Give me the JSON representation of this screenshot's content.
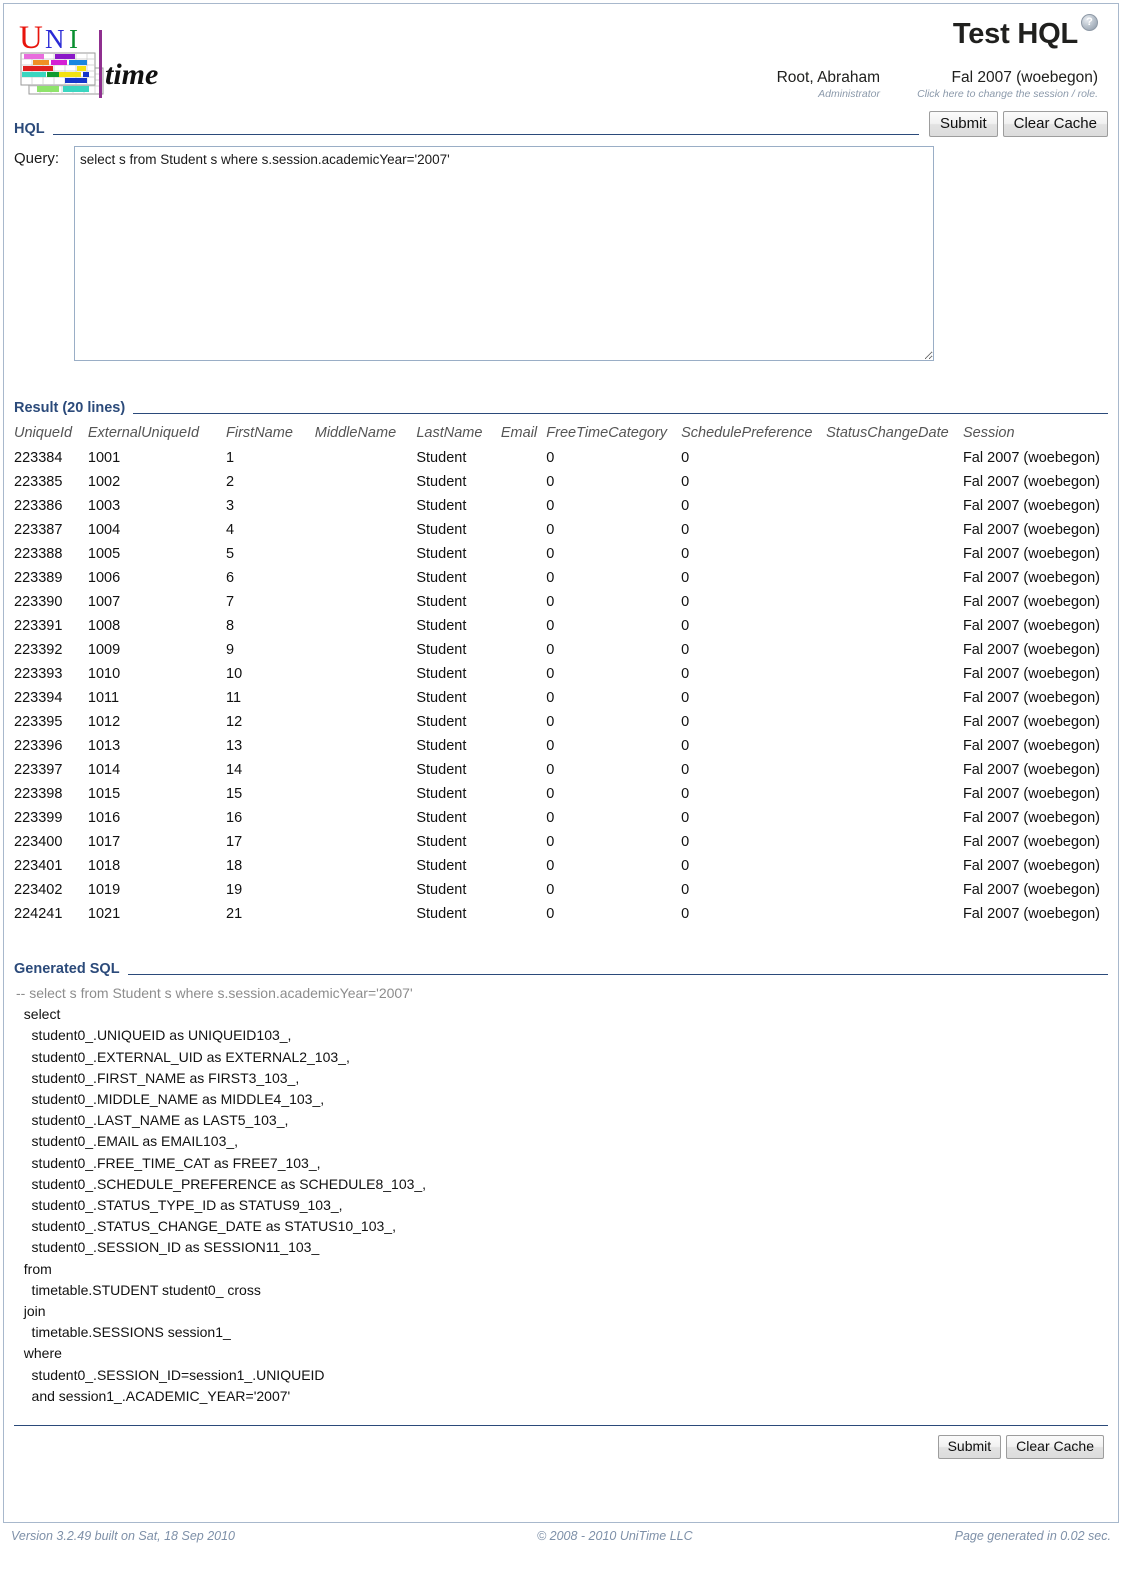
{
  "header": {
    "app_title": "Test HQL",
    "help_badge": "?",
    "logo_alt": "UniTime",
    "logo_text_uni": "UNI",
    "logo_text_time": "time",
    "user_name": "Root, Abraham",
    "user_role": "Administrator",
    "session_name": "Fal 2007 (woebegon)",
    "session_hint": "Click here to change the session / role."
  },
  "hql_section": {
    "title": "HQL",
    "submit_label": "Submit",
    "clear_cache_label": "Clear Cache",
    "query_label": "Query:",
    "query_value": "select s from Student s where s.session.academicYear='2007'",
    "query_placeholder": ""
  },
  "result_section": {
    "title": "Result (20 lines)",
    "columns": [
      "UniqueId",
      "ExternalUniqueId",
      "FirstName",
      "MiddleName",
      "LastName",
      "Email",
      "FreeTimeCategory",
      "SchedulePreference",
      "StatusChangeDate",
      "Session"
    ],
    "rows": [
      [
        "223384",
        "1001",
        "1",
        "",
        "Student",
        "",
        "0",
        "0",
        "",
        "Fal 2007 (woebegon)"
      ],
      [
        "223385",
        "1002",
        "2",
        "",
        "Student",
        "",
        "0",
        "0",
        "",
        "Fal 2007 (woebegon)"
      ],
      [
        "223386",
        "1003",
        "3",
        "",
        "Student",
        "",
        "0",
        "0",
        "",
        "Fal 2007 (woebegon)"
      ],
      [
        "223387",
        "1004",
        "4",
        "",
        "Student",
        "",
        "0",
        "0",
        "",
        "Fal 2007 (woebegon)"
      ],
      [
        "223388",
        "1005",
        "5",
        "",
        "Student",
        "",
        "0",
        "0",
        "",
        "Fal 2007 (woebegon)"
      ],
      [
        "223389",
        "1006",
        "6",
        "",
        "Student",
        "",
        "0",
        "0",
        "",
        "Fal 2007 (woebegon)"
      ],
      [
        "223390",
        "1007",
        "7",
        "",
        "Student",
        "",
        "0",
        "0",
        "",
        "Fal 2007 (woebegon)"
      ],
      [
        "223391",
        "1008",
        "8",
        "",
        "Student",
        "",
        "0",
        "0",
        "",
        "Fal 2007 (woebegon)"
      ],
      [
        "223392",
        "1009",
        "9",
        "",
        "Student",
        "",
        "0",
        "0",
        "",
        "Fal 2007 (woebegon)"
      ],
      [
        "223393",
        "1010",
        "10",
        "",
        "Student",
        "",
        "0",
        "0",
        "",
        "Fal 2007 (woebegon)"
      ],
      [
        "223394",
        "1011",
        "11",
        "",
        "Student",
        "",
        "0",
        "0",
        "",
        "Fal 2007 (woebegon)"
      ],
      [
        "223395",
        "1012",
        "12",
        "",
        "Student",
        "",
        "0",
        "0",
        "",
        "Fal 2007 (woebegon)"
      ],
      [
        "223396",
        "1013",
        "13",
        "",
        "Student",
        "",
        "0",
        "0",
        "",
        "Fal 2007 (woebegon)"
      ],
      [
        "223397",
        "1014",
        "14",
        "",
        "Student",
        "",
        "0",
        "0",
        "",
        "Fal 2007 (woebegon)"
      ],
      [
        "223398",
        "1015",
        "15",
        "",
        "Student",
        "",
        "0",
        "0",
        "",
        "Fal 2007 (woebegon)"
      ],
      [
        "223399",
        "1016",
        "16",
        "",
        "Student",
        "",
        "0",
        "0",
        "",
        "Fal 2007 (woebegon)"
      ],
      [
        "223400",
        "1017",
        "17",
        "",
        "Student",
        "",
        "0",
        "0",
        "",
        "Fal 2007 (woebegon)"
      ],
      [
        "223401",
        "1018",
        "18",
        "",
        "Student",
        "",
        "0",
        "0",
        "",
        "Fal 2007 (woebegon)"
      ],
      [
        "223402",
        "1019",
        "19",
        "",
        "Student",
        "",
        "0",
        "0",
        "",
        "Fal 2007 (woebegon)"
      ],
      [
        "224241",
        "1021",
        "21",
        "",
        "Student",
        "",
        "0",
        "0",
        "",
        "Fal 2007 (woebegon)"
      ]
    ]
  },
  "sql_section": {
    "title": "Generated SQL",
    "comment_line": "-- select s from Student s where s.session.academicYear='2007'",
    "body": "  select\n    student0_.UNIQUEID as UNIQUEID103_,\n    student0_.EXTERNAL_UID as EXTERNAL2_103_,\n    student0_.FIRST_NAME as FIRST3_103_,\n    student0_.MIDDLE_NAME as MIDDLE4_103_,\n    student0_.LAST_NAME as LAST5_103_,\n    student0_.EMAIL as EMAIL103_,\n    student0_.FREE_TIME_CAT as FREE7_103_,\n    student0_.SCHEDULE_PREFERENCE as SCHEDULE8_103_,\n    student0_.STATUS_TYPE_ID as STATUS9_103_,\n    student0_.STATUS_CHANGE_DATE as STATUS10_103_,\n    student0_.SESSION_ID as SESSION11_103_\n  from\n    timetable.STUDENT student0_ cross\n  join\n    timetable.SESSIONS session1_\n  where\n    student0_.SESSION_ID=session1_.UNIQUEID\n    and session1_.ACADEMIC_YEAR='2007'"
  },
  "bottom_bar": {
    "submit_label": "Submit",
    "clear_cache_label": "Clear Cache"
  },
  "footer": {
    "version": "Version 3.2.49 built on Sat, 18 Sep 2010",
    "copyright": "© 2008 - 2010 UniTime LLC",
    "generated": "Page generated in 0.02 sec."
  },
  "colors": {
    "section_heading": "#2b4a7a",
    "frame_border": "#a8b8cc",
    "footer_text": "#7e90a8",
    "column_header": "#555555",
    "sql_comment": "#8d8d8d",
    "logo_u": "#e8140c",
    "logo_n": "#2b2bd6",
    "logo_i": "#0a8f30",
    "logo_bar": "#8f2f8f"
  }
}
